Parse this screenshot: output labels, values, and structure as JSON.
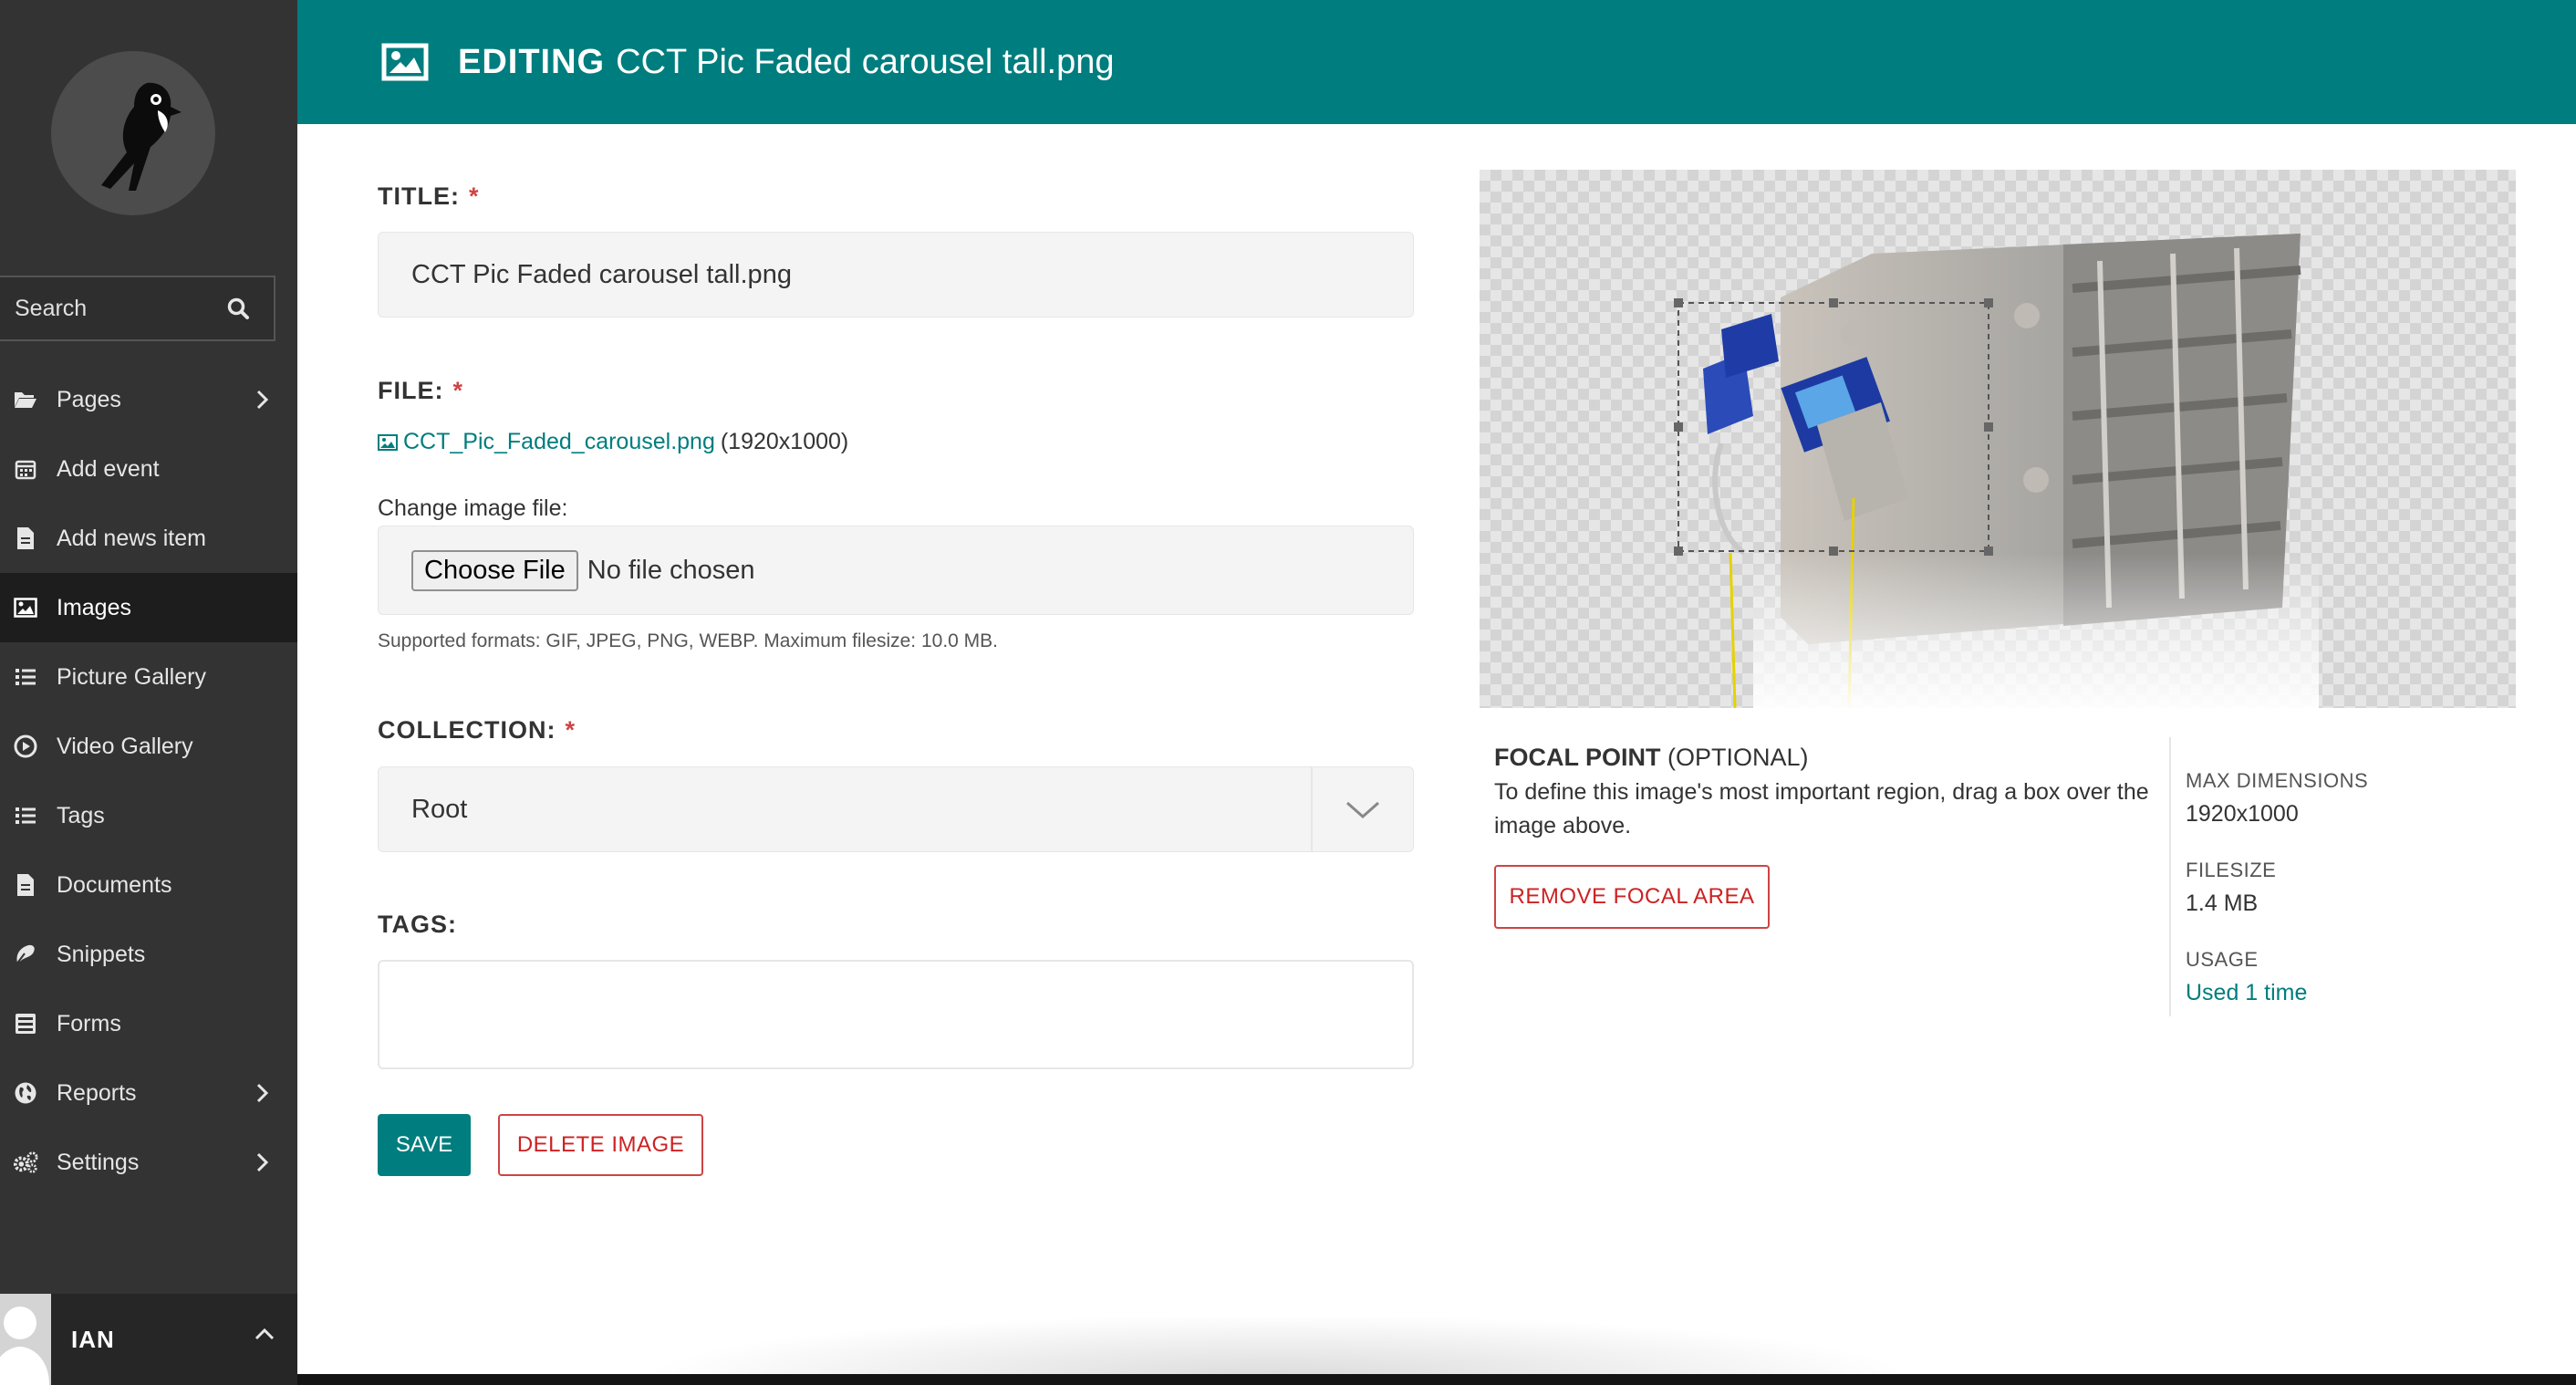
{
  "sidebar": {
    "search": {
      "label": "Search"
    },
    "items": [
      {
        "label": "Pages",
        "icon": "folder-open-icon",
        "has_submenu": true
      },
      {
        "label": "Add event",
        "icon": "calendar-icon",
        "has_submenu": false
      },
      {
        "label": "Add news item",
        "icon": "document-icon",
        "has_submenu": false
      },
      {
        "label": "Images",
        "icon": "image-icon",
        "has_submenu": false,
        "active": true
      },
      {
        "label": "Picture Gallery",
        "icon": "list-icon",
        "has_submenu": false
      },
      {
        "label": "Video Gallery",
        "icon": "play-circle-icon",
        "has_submenu": false
      },
      {
        "label": "Tags",
        "icon": "list-icon",
        "has_submenu": false
      },
      {
        "label": "Documents",
        "icon": "document-icon",
        "has_submenu": false
      },
      {
        "label": "Snippets",
        "icon": "snippet-icon",
        "has_submenu": false
      },
      {
        "label": "Forms",
        "icon": "form-icon",
        "has_submenu": false
      },
      {
        "label": "Reports",
        "icon": "globe-icon",
        "has_submenu": true
      },
      {
        "label": "Settings",
        "icon": "cogs-icon",
        "has_submenu": true
      }
    ],
    "account": {
      "name": "IAN"
    }
  },
  "header": {
    "prefix": "EDITING",
    "title": "CCT Pic Faded carousel tall.png",
    "icon": "image-icon"
  },
  "form": {
    "title": {
      "label": "TITLE:",
      "required": "*",
      "value": "CCT Pic Faded carousel tall.png"
    },
    "file": {
      "label": "FILE:",
      "required": "*",
      "filename": "CCT_Pic_Faded_carousel.png",
      "dimensions": "(1920x1000)",
      "change_label": "Change image file:",
      "choose_button": "Choose File",
      "no_file": "No file chosen",
      "help": "Supported formats: GIF, JPEG, PNG, WEBP. Maximum filesize: 10.0 MB."
    },
    "collection": {
      "label": "COLLECTION:",
      "required": "*",
      "selected": "Root"
    },
    "tags": {
      "label": "TAGS:",
      "value": ""
    },
    "save_button": "SAVE",
    "delete_button": "DELETE IMAGE"
  },
  "focal": {
    "title": "FOCAL POINT",
    "optional": "(OPTIONAL)",
    "description": "To define this image's most important region, drag a box over the image above.",
    "remove_button": "REMOVE FOCAL AREA"
  },
  "meta": {
    "max_dimensions_label": "MAX DIMENSIONS",
    "max_dimensions_value": "1920x1000",
    "filesize_label": "FILESIZE",
    "filesize_value": "1.4 MB",
    "usage_label": "USAGE",
    "usage_value": "Used 1 time"
  },
  "colors": {
    "brand": "#007d7e",
    "sidebar": "#333333",
    "danger": "#cd4444"
  }
}
